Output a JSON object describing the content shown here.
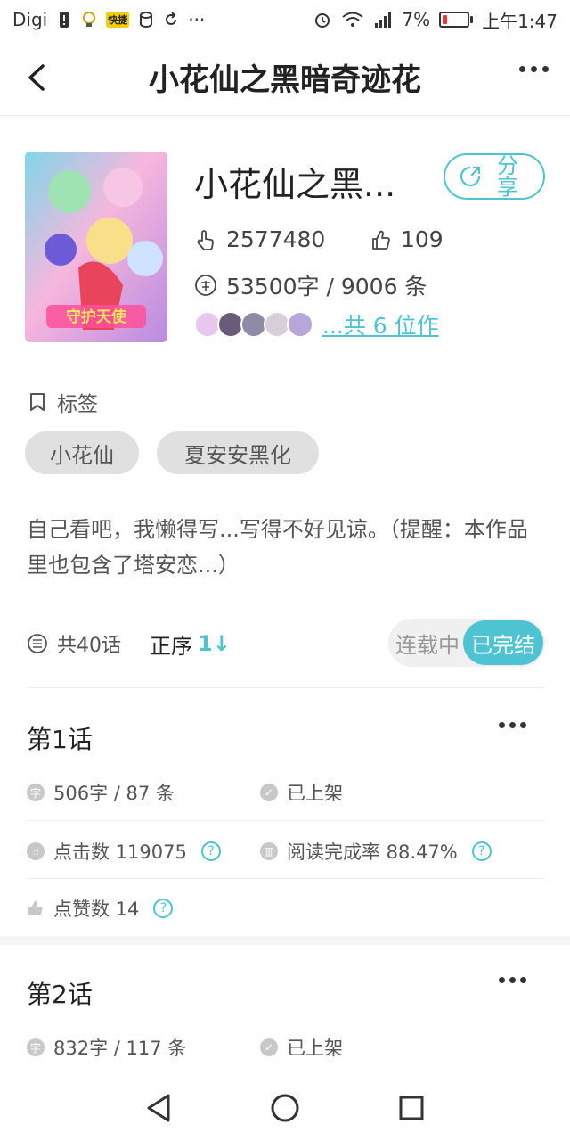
{
  "status_bar": {
    "carrier": "Digi",
    "notif_text": "快捷",
    "overflow": "···",
    "battery": "7%",
    "time": "上午1:47"
  },
  "nav": {
    "title": "小花仙之黑暗奇迹花"
  },
  "work": {
    "title": "小花仙之黑...",
    "share_label": "分享",
    "clicks": "2577480",
    "likes": "109",
    "words_entries": "53500字 / 9006 条",
    "authors_link": "...共 6 位作",
    "cover_text": "守护天使"
  },
  "tags": {
    "heading": "标签",
    "items": [
      "小花仙",
      "夏安安黑化"
    ]
  },
  "description": "自己看吧，我懒得写...写得不好见谅。（提醒：本作品里也包含了塔安恋...）",
  "list": {
    "count": "共40话",
    "order": "正序",
    "order_icon": "1↓",
    "status_options": [
      "连载中",
      "已完结"
    ],
    "status_selected": "已完结"
  },
  "chapters": [
    {
      "title": "第1话",
      "words": "506字 / 87 条",
      "status": "已上架",
      "clicks": "点击数 119075",
      "read_rate": "阅读完成率 88.47%",
      "likes": "点赞数 14"
    },
    {
      "title": "第2话",
      "words": "832字 / 117 条",
      "status": "已上架"
    }
  ],
  "colors": {
    "accent": "#4ec3d1",
    "chip_bg": "#e0e0e0",
    "battery_low": "#e53935"
  },
  "icons": [
    "back-arrow-icon",
    "more-icon",
    "share-icon",
    "hand-tap-icon",
    "thumb-up-icon",
    "word-icon",
    "tag-icon",
    "list-icon",
    "sort-icon",
    "check-icon",
    "question-icon",
    "nav-back-icon",
    "nav-home-icon",
    "nav-recents-icon"
  ]
}
